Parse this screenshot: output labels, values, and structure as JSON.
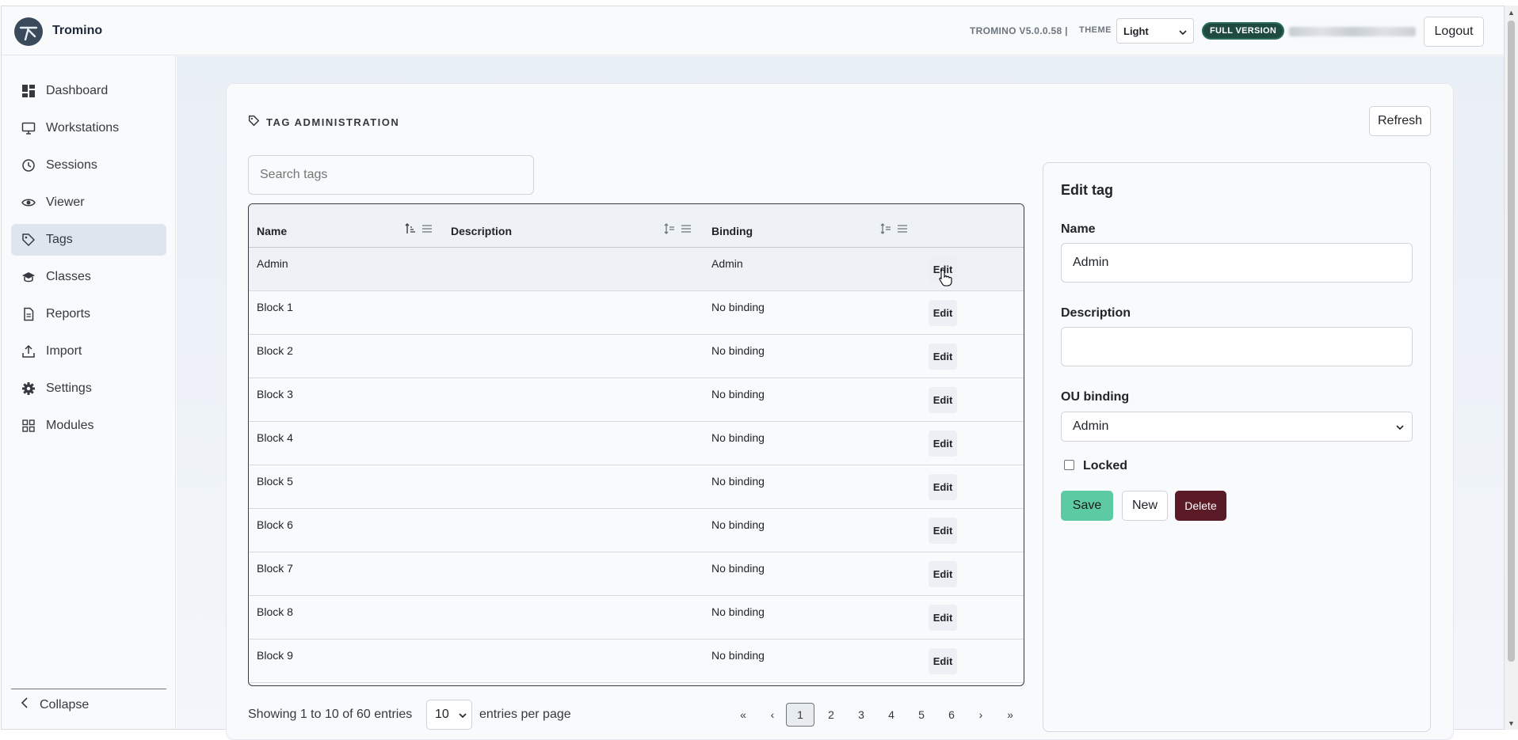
{
  "header": {
    "brand": "Tromino",
    "version": "TROMINO V5.0.0.58 |",
    "theme_label": "THEME",
    "theme_value": "Light",
    "badge": "FULL VERSION",
    "logout": "Logout"
  },
  "sidebar": {
    "items": [
      {
        "label": "Dashboard",
        "icon": "dashboard-icon"
      },
      {
        "label": "Workstations",
        "icon": "monitor-icon"
      },
      {
        "label": "Sessions",
        "icon": "clock-icon"
      },
      {
        "label": "Viewer",
        "icon": "eye-icon"
      },
      {
        "label": "Tags",
        "icon": "tag-icon",
        "active": true
      },
      {
        "label": "Classes",
        "icon": "graduation-cap-icon"
      },
      {
        "label": "Reports",
        "icon": "document-icon"
      },
      {
        "label": "Import",
        "icon": "upload-icon"
      },
      {
        "label": "Settings",
        "icon": "gear-icon"
      },
      {
        "label": "Modules",
        "icon": "grid-icon"
      }
    ],
    "collapse": "Collapse"
  },
  "main": {
    "title": "TAG ADMINISTRATION",
    "refresh": "Refresh",
    "search_placeholder": "Search tags"
  },
  "table": {
    "columns": [
      "Name",
      "Description",
      "Binding"
    ],
    "edit_label": "Edit",
    "rows": [
      {
        "name": "Admin",
        "description": "",
        "binding": "Admin"
      },
      {
        "name": "Block 1",
        "description": "",
        "binding": "No binding"
      },
      {
        "name": "Block 2",
        "description": "",
        "binding": "No binding"
      },
      {
        "name": "Block 3",
        "description": "",
        "binding": "No binding"
      },
      {
        "name": "Block 4",
        "description": "",
        "binding": "No binding"
      },
      {
        "name": "Block 5",
        "description": "",
        "binding": "No binding"
      },
      {
        "name": "Block 6",
        "description": "",
        "binding": "No binding"
      },
      {
        "name": "Block 7",
        "description": "",
        "binding": "No binding"
      },
      {
        "name": "Block 8",
        "description": "",
        "binding": "No binding"
      },
      {
        "name": "Block 9",
        "description": "",
        "binding": "No binding"
      }
    ]
  },
  "pagination": {
    "showing": "Showing 1 to 10 of 60 entries",
    "per_page_value": "10",
    "per_page_label": "entries per page",
    "first": "«",
    "prev": "‹",
    "pages": [
      "1",
      "2",
      "3",
      "4",
      "5",
      "6"
    ],
    "current": "1",
    "next": "›",
    "last": "»"
  },
  "edit_panel": {
    "title": "Edit tag",
    "name_label": "Name",
    "name_value": "Admin",
    "description_label": "Description",
    "description_value": "",
    "ou_label": "OU binding",
    "ou_value": "Admin",
    "locked_label": "Locked",
    "save": "Save",
    "new": "New",
    "delete": "Delete"
  },
  "colors": {
    "save": "#5ccba3",
    "delete": "#5a1a26",
    "badge": "#1f4a3f",
    "active_nav": "#dfe5ee"
  }
}
